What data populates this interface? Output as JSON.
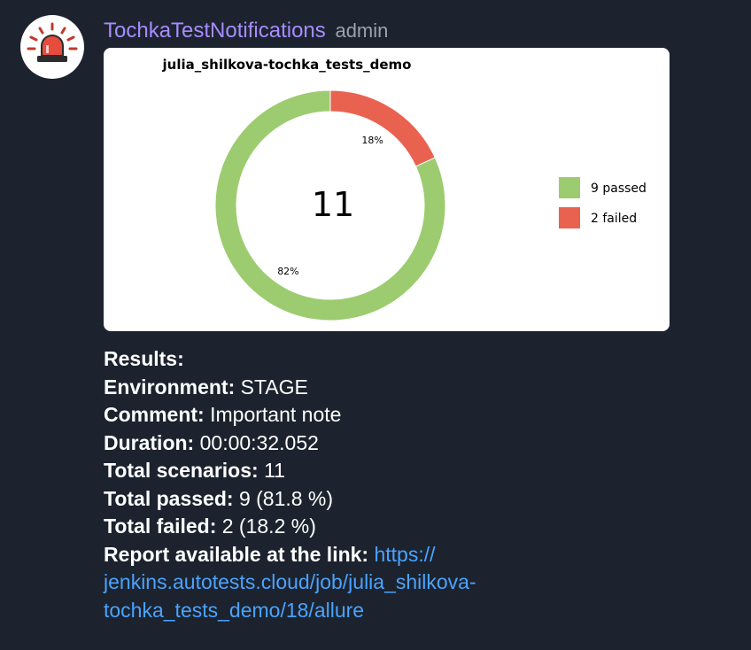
{
  "sender": {
    "name": "TochkaTestNotifications",
    "role": "admin",
    "avatar_icon": "siren-icon"
  },
  "chart_data": {
    "type": "pie",
    "title": "julia_shilkova-tochka_tests_demo",
    "center_label": "11",
    "slices": [
      {
        "name": "passed",
        "value": 9,
        "percent_label": "82%",
        "color": "#9ccc6f",
        "legend": "9 passed"
      },
      {
        "name": "failed",
        "value": 2,
        "percent_label": "18%",
        "color": "#e9624f",
        "legend": "2 failed"
      }
    ],
    "legend_position": "right"
  },
  "results": {
    "heading": "Results:",
    "environment_label": "Environment:",
    "environment_value": "STAGE",
    "comment_label": "Comment:",
    "comment_value": "Important note",
    "duration_label": "Duration:",
    "duration_value": "00:00:32.052",
    "total_scenarios_label": "Total scenarios:",
    "total_scenarios_value": "11",
    "total_passed_label": "Total passed:",
    "total_passed_value": "9 (81.8 %)",
    "total_failed_label": "Total failed:",
    "total_failed_value": "2 (18.2 %)",
    "report_label": "Report available at the link:",
    "report_link_line1": "https://",
    "report_link_line2": "jenkins.autotests.cloud/job/julia_shilkova-",
    "report_link_line3": "tochka_tests_demo/18/allure"
  },
  "colors": {
    "background": "#1c232e",
    "sender_name": "#a78cff",
    "link": "#4aa3ff",
    "passed": "#9ccc6f",
    "failed": "#e9624f"
  }
}
